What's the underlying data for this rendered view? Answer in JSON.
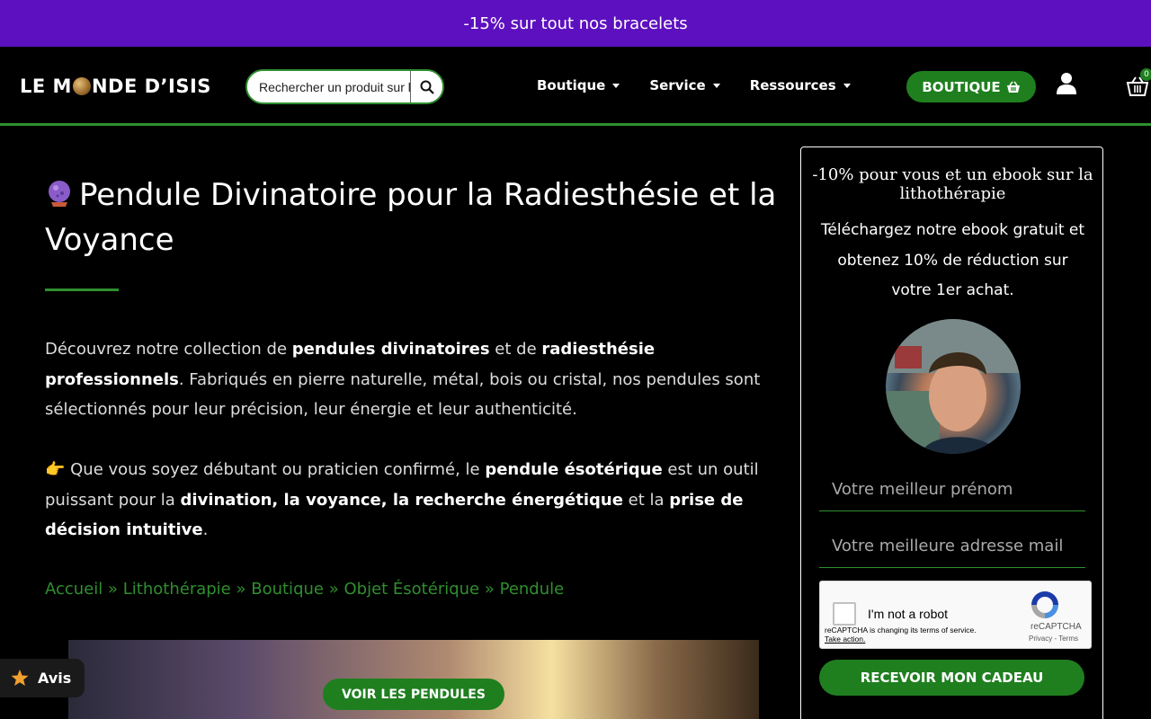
{
  "promo": {
    "text": "-15% sur tout nos bracelets"
  },
  "header": {
    "logo_part1": "LE M",
    "logo_part2": "NDE D’ISIS",
    "search_placeholder": "Rechercher un produit sur le site",
    "nav": [
      {
        "label": "Boutique"
      },
      {
        "label": "Service"
      },
      {
        "label": "Ressources"
      }
    ],
    "boutique_button": "BOUTIQUE",
    "cart_count": "0"
  },
  "main": {
    "title": "Pendule Divinatoire pour la Radiesthésie et la Voyance",
    "p1": {
      "t1": "Découvrez notre collection de ",
      "b1": "pendules divinatoires",
      "t2": " et de ",
      "b2": "radiesthésie professionnels",
      "t3": ". Fabriqués en pierre naturelle, métal, bois ou cristal, nos pendules sont sélectionnés pour leur précision, leur énergie et leur authenticité."
    },
    "p2": {
      "emoji": "👉",
      "t1": " Que vous soyez débutant ou praticien confirmé, le ",
      "b1": "pendule ésotérique",
      "t2": " est un outil puissant pour la ",
      "b2": "divination, la voyance, la recherche énergétique",
      "t3": " et la ",
      "b3": "prise de décision intuitive",
      "t4": "."
    },
    "breadcrumb": [
      {
        "label": "Accueil"
      },
      {
        "label": "Lithothérapie"
      },
      {
        "label": "Boutique"
      },
      {
        "label": "Objet Ésotérique"
      },
      {
        "label": "Pendule"
      }
    ],
    "breadcrumb_sep": "»",
    "pendules_button": "VOIR LES PENDULES",
    "avis_label": "Avis"
  },
  "sidebar": {
    "title": "-10% pour vous et un ebook sur la lithothérapie",
    "text": "Téléchargez notre ebook gratuit et obtenez 10% de réduction sur votre 1er achat.",
    "firstname_placeholder": "Votre meilleur prénom",
    "email_placeholder": "Votre meilleure adresse mail",
    "recaptcha": {
      "label": "I'm not a robot",
      "terms_line": "reCAPTCHA is changing its terms of service.",
      "take_action": "Take action.",
      "brand": "reCAPTCHA",
      "privacy": "Privacy",
      "terms": "Terms"
    },
    "submit_button": "RECEVOIR MON CADEAU"
  }
}
